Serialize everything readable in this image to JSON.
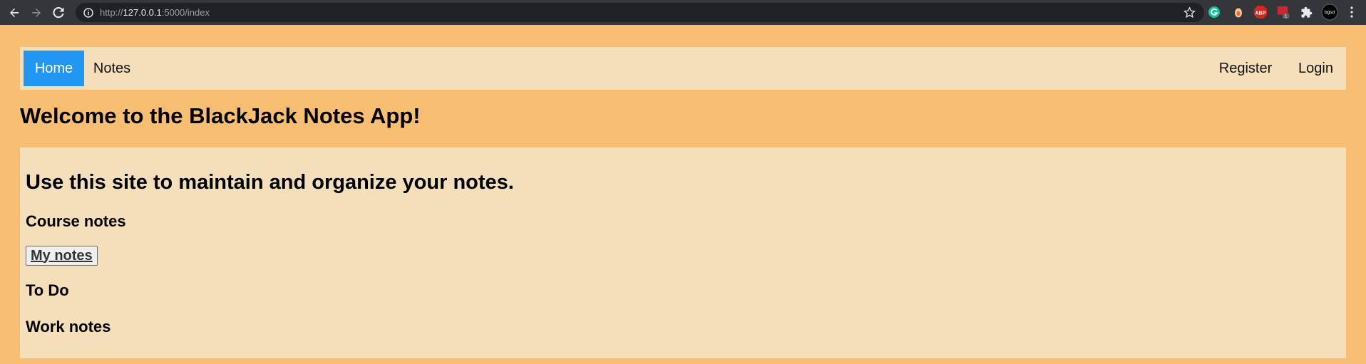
{
  "browser": {
    "url_prefix": "http://",
    "url_host": "127.0.0.1",
    "url_rest": ":5000/index",
    "extensions": {
      "abp_label": "ABP",
      "badge_count": "1",
      "profile_label": "bgsd"
    }
  },
  "navbar": {
    "home_label": "Home",
    "notes_label": "Notes",
    "register_label": "Register",
    "login_label": "Login",
    "active_color": "#2196f3"
  },
  "page": {
    "title": "Welcome to the BlackJack Notes App!",
    "subtitle": "Use this site to maintain and organize your notes.",
    "sections": {
      "course": "Course notes",
      "my_notes_button": "My notes",
      "todo": "To Do",
      "work": "Work notes"
    }
  },
  "colors": {
    "background": "#f8bf72",
    "panel": "#f5deba"
  }
}
